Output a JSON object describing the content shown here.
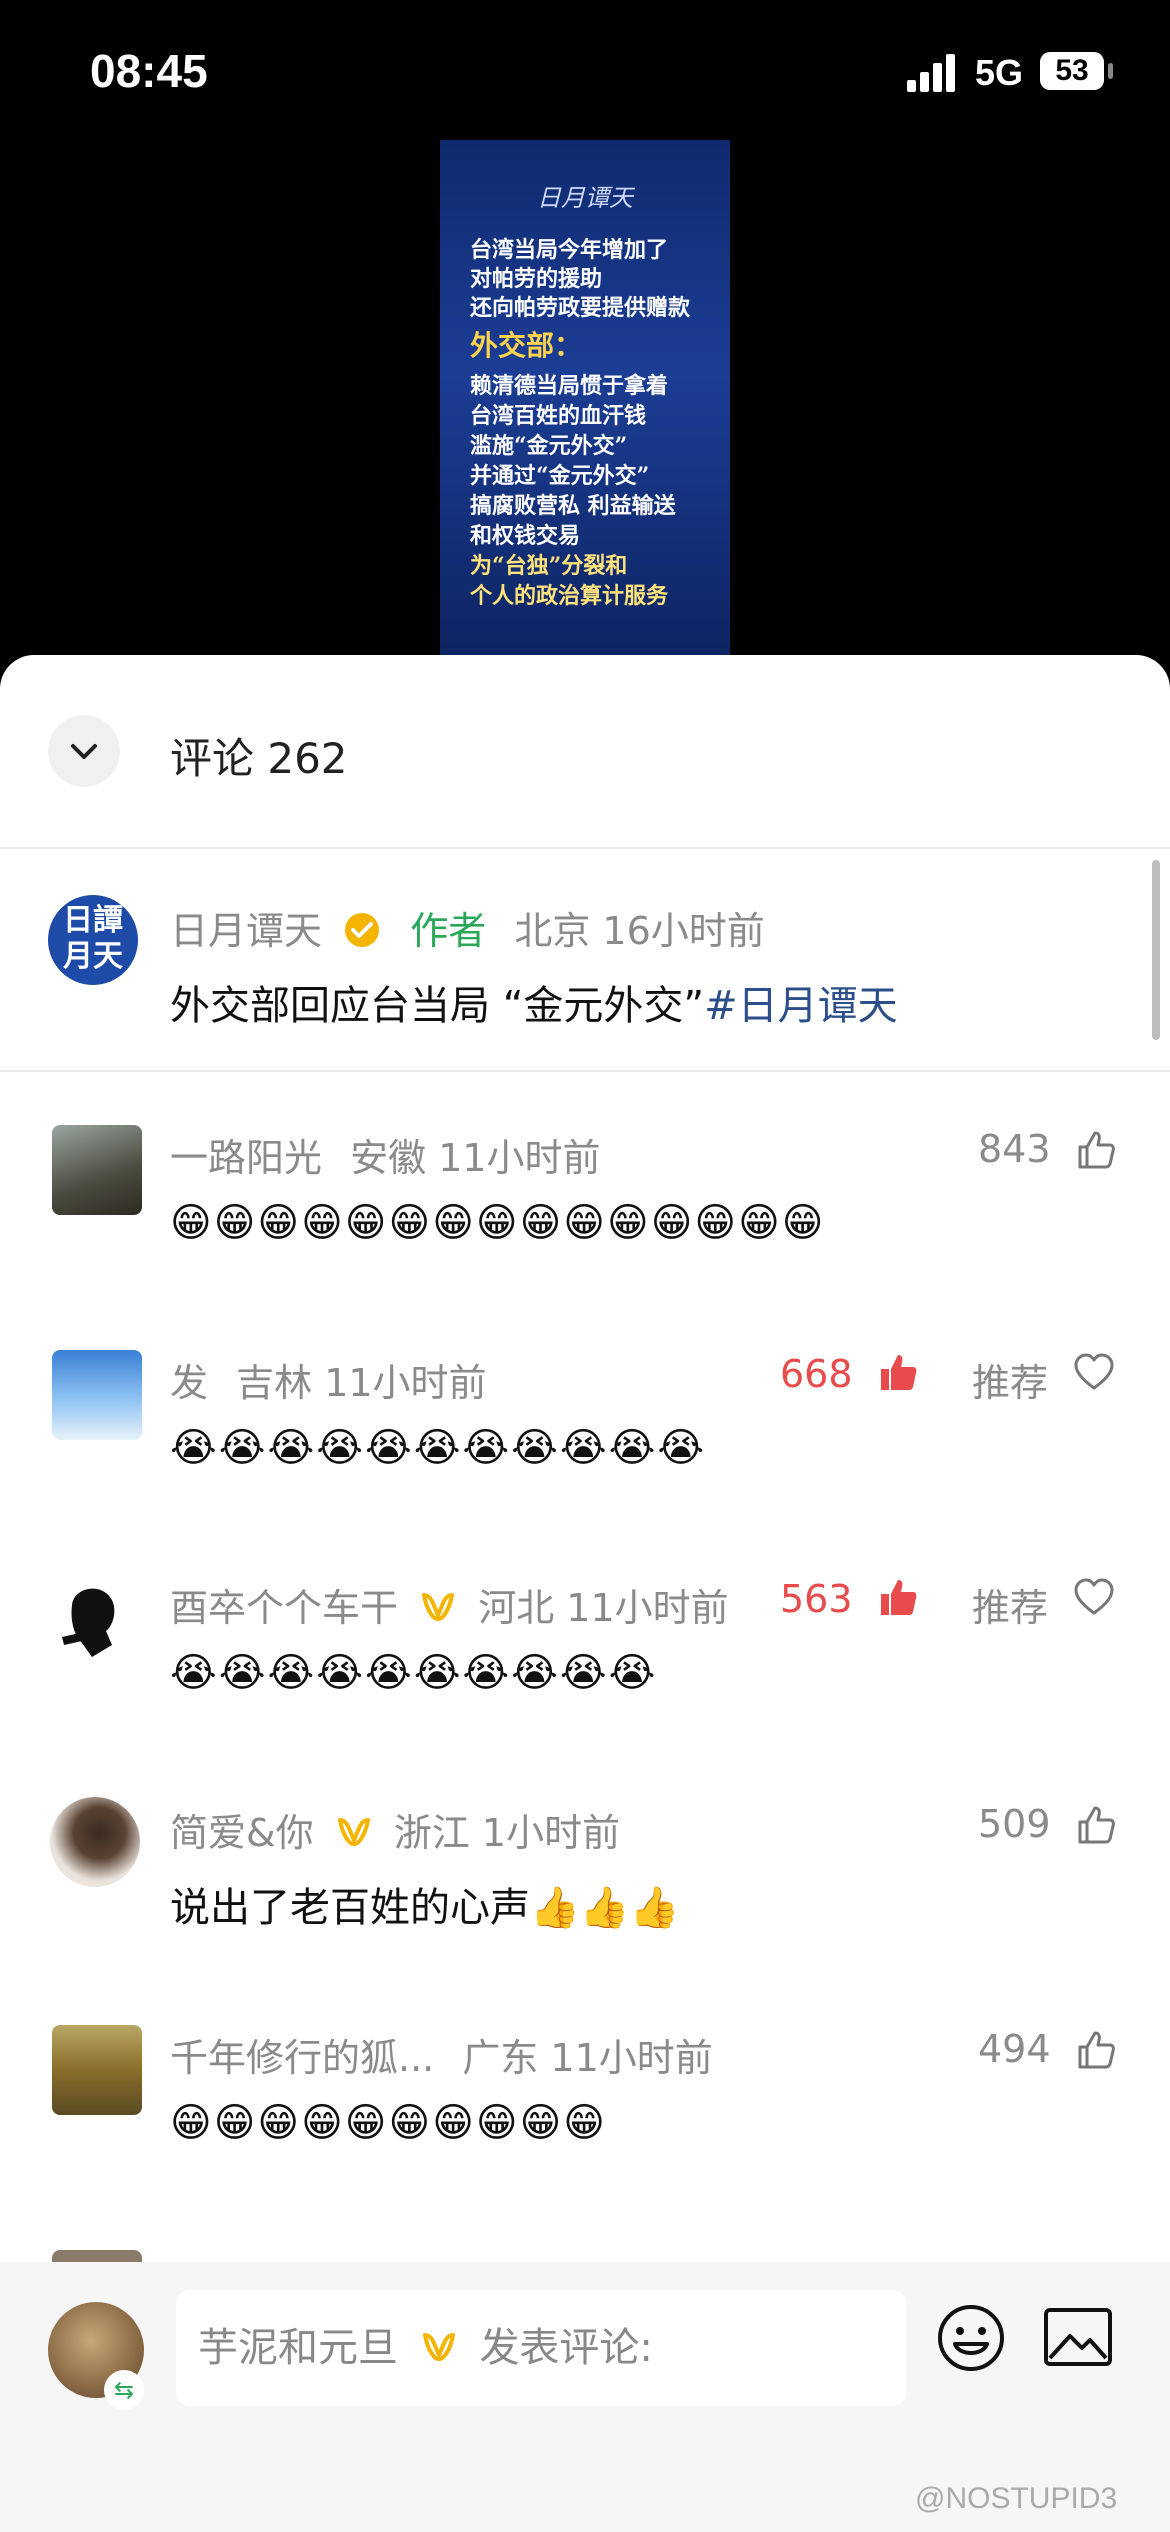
{
  "status_bar": {
    "time": "08:45",
    "network": "5G",
    "battery": "53"
  },
  "video": {
    "logo": "日月谭天",
    "lines": [
      "台湾当局今年增加了",
      "对帕劳的援助",
      "还向帕劳政要提供赠款"
    ],
    "heading": "外交部：",
    "lines2": [
      "赖清德当局惯于拿着",
      "台湾百姓的血汗钱",
      "滥施“金元外交”",
      "并通过“金元外交”",
      "搞腐败营私 利益输送",
      "和权钱交易",
      "为“台独”分裂和",
      "个人的政治算计服务"
    ]
  },
  "sheet": {
    "title": "评论 262"
  },
  "pinned": {
    "avatar_text": "日譚\n月天",
    "author": "日月谭天",
    "author_tag": "作者",
    "meta": "北京 16小时前",
    "text": "外交部回应台当局 “金元外交”",
    "hashtag": "#日月谭天"
  },
  "comments": [
    {
      "name": "一路阳光",
      "meta": "安徽 11小时前",
      "likes": "843",
      "liked": false,
      "recommend": "",
      "emoji": "😁😁😁😁😁😁😁😁😁😁😁😁😁😁😁"
    },
    {
      "name": "发",
      "meta": "吉林 11小时前",
      "likes": "668",
      "liked": true,
      "recommend": "推荐",
      "emoji": "😭😭😭😭😭😭😭😭😭😭😭"
    },
    {
      "name": "酉卒个个车干",
      "meta": "河北 11小时前",
      "likes": "563",
      "liked": true,
      "recommend": "推荐",
      "emoji": "😭😭😭😭😭😭😭😭😭😭"
    },
    {
      "name": "简爱&你",
      "meta": "浙江 1小时前",
      "likes": "509",
      "liked": false,
      "recommend": "",
      "text": "说出了老百姓的心声👍👍👍"
    },
    {
      "name": "千年修行的狐...",
      "meta": "广东 11小时前",
      "likes": "494",
      "liked": false,
      "recommend": "",
      "emoji": "😁😁😁😁😁😁😁😁😁😁"
    }
  ],
  "bottom_bar": {
    "user": "芋泥和元旦",
    "placeholder": "发表评论:"
  },
  "watermark": "@NOSTUPID3",
  "colors": {
    "author_green": "#2aa85a",
    "like_red": "#e84b4b",
    "hashtag_blue": "#2c4f8a",
    "badge_gold": "#f5b400"
  },
  "icons": [
    "chevron-down-icon",
    "verified-icon",
    "thumbs-up-icon",
    "heart-icon",
    "vip-ribbon-icon",
    "emoji-icon",
    "image-icon"
  ]
}
